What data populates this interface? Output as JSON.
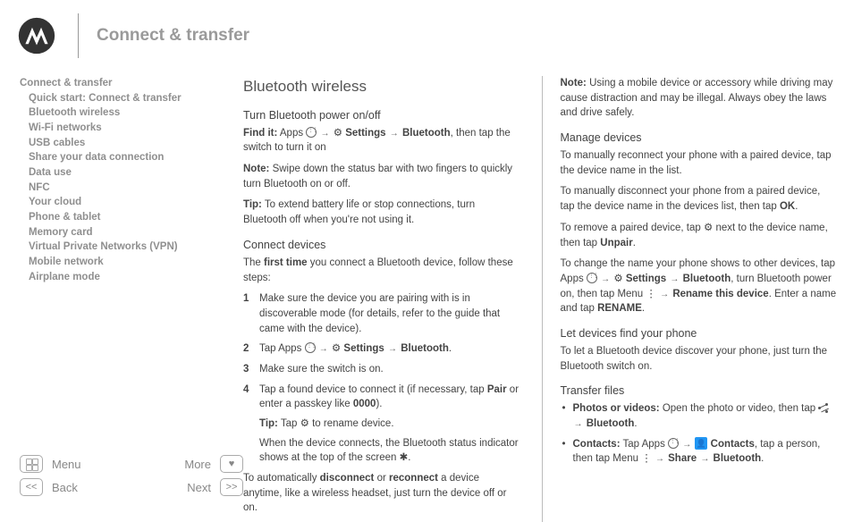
{
  "header": {
    "title": "Connect & transfer"
  },
  "sidebar": {
    "title": "Connect & transfer",
    "items": [
      "Quick start: Connect & transfer",
      "Bluetooth wireless",
      "Wi-Fi networks",
      "USB cables",
      "Share your data connection",
      "Data use",
      "NFC",
      "Your cloud",
      "Phone & tablet",
      "Memory card",
      "Virtual Private Networks (VPN)",
      "Mobile network",
      "Airplane mode"
    ]
  },
  "col1": {
    "h2": "Bluetooth wireless",
    "s1_h3": "Turn Bluetooth power on/off",
    "s1_findit_label": "Find it:",
    "s1_findit_apps": " Apps ",
    "s1_findit_settings": " Settings",
    "s1_findit_bt": "Bluetooth",
    "s1_findit_tail": ", then tap the switch to turn it on",
    "s1_note_label": "Note:",
    "s1_note_text": " Swipe down the status bar with two fingers to quickly turn Bluetooth on or off.",
    "s1_tip_label": "Tip:",
    "s1_tip_text": " To extend battery life or stop connections, turn Bluetooth off when you're not using it.",
    "s2_h3": "Connect devices",
    "s2_intro_a": "The ",
    "s2_intro_b": "first time",
    "s2_intro_c": " you connect a Bluetooth device, follow these steps:",
    "s2_li1": "Make sure the device you are pairing with is in discoverable mode (for details, refer to the guide that came with the device).",
    "s2_li2_a": "Tap Apps ",
    "s2_li2_settings": " Settings",
    "s2_li2_bt": "Bluetooth",
    "s2_li3": "Make sure the switch is on.",
    "s2_li4_a": "Tap a found device to connect it (if necessary, tap ",
    "s2_li4_pair": "Pair",
    "s2_li4_b": " or enter a passkey like ",
    "s2_li4_code": "0000",
    "s2_li4_c": ").",
    "s2_li4_tip_label": "Tip:",
    "s2_li4_tip_a": " Tap ",
    "s2_li4_tip_b": " to rename device.",
    "s2_li4_d": "When the device connects, the Bluetooth status indicator shows at the top of the screen ",
    "s2_li4_e": ".",
    "s2_auto_a": "To automatically ",
    "s2_auto_disc": "disconnect",
    "s2_auto_b": " or ",
    "s2_auto_rec": "reconnect",
    "s2_auto_c": " a device anytime, like a wireless headset, just turn the device off or on."
  },
  "col2": {
    "top_note_label": "Note:",
    "top_note_text": " Using a mobile device or accessory while driving may cause distraction and may be illegal. Always obey the laws and drive safely.",
    "s3_h3": "Manage devices",
    "s3_p1": "To manually reconnect your phone with a paired device, tap the device name in the list.",
    "s3_p2_a": "To manually disconnect your phone from a paired device, tap the device name in the devices list, then tap ",
    "s3_p2_ok": "OK",
    "s3_p2_b": ".",
    "s3_p3_a": "To remove a paired device, tap ",
    "s3_p3_b": " next to the device name, then tap ",
    "s3_p3_unpair": "Unpair",
    "s3_p3_c": ".",
    "s3_p4_a": "To change the name your phone shows to other devices, tap Apps ",
    "s3_p4_settings": " Settings",
    "s3_p4_bt": "Bluetooth",
    "s3_p4_b": ", turn Bluetooth power on, then tap Menu ",
    "s3_p4_rename": "Rename this device",
    "s3_p4_c": ". Enter a name and tap ",
    "s3_p4_renamebtn": "RENAME",
    "s3_p4_d": ".",
    "s4_h3": "Let devices find your phone",
    "s4_p1": "To let a Bluetooth device discover your phone, just turn the Bluetooth switch on.",
    "s5_h3": "Transfer files",
    "s5_li1_label": "Photos or videos:",
    "s5_li1_a": " Open the photo or video, then tap ",
    "s5_li1_bt": "Bluetooth",
    "s5_li1_b": ".",
    "s5_li2_label": "Contacts:",
    "s5_li2_a": " Tap Apps ",
    "s5_li2_contacts": " Contacts",
    "s5_li2_b": ", tap a person, then tap Menu ",
    "s5_li2_share": "Share",
    "s5_li2_bt": "Bluetooth",
    "s5_li2_c": "."
  },
  "nav": {
    "menu": "Menu",
    "more": "More",
    "back": "Back",
    "next": "Next"
  },
  "glyphs": {
    "arrow": "→",
    "gear": "⚙",
    "menu_dots": "⋮",
    "bt": "✱",
    "heart": "♥",
    "prev": "<<",
    "next": ">>"
  }
}
